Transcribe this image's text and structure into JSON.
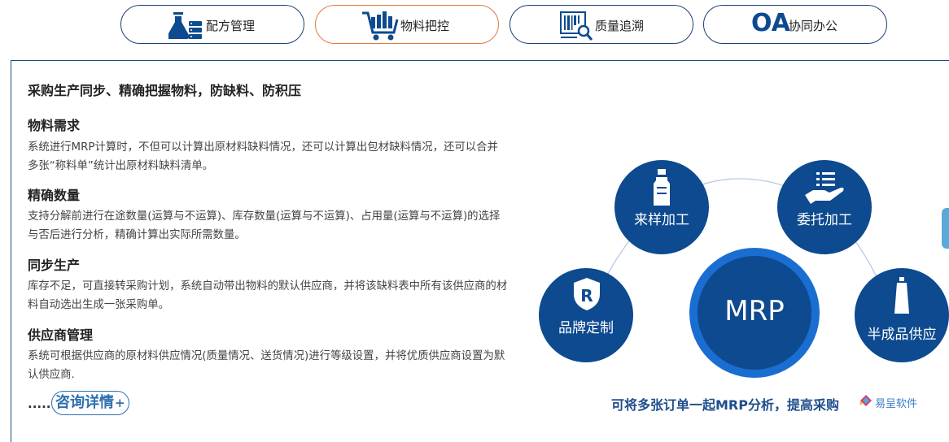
{
  "tabs": [
    {
      "label": "配方管理",
      "icon": "flask-server-icon"
    },
    {
      "label": "物料把控",
      "icon": "shopping-cart-icon",
      "active": true
    },
    {
      "label": "质量追溯",
      "icon": "barcode-search-icon"
    },
    {
      "label": "协同办公",
      "icon": "oa-logo-icon",
      "icon_text": "OA"
    }
  ],
  "headline": "采购生产同步、精确把握物料，防缺料、防积压",
  "sections": [
    {
      "title": "物料需求",
      "body": "系统进行MRP计算时，不但可以计算出原材料缺料情况，还可以计算出包材缺料情况，还可以合并多张“称料单”统计出原材料缺料清单。"
    },
    {
      "title": "精确数量",
      "body": "支持分解前进行在途数量(运算与不运算)、库存数量(运算与不运算)、占用量(运算与不运算)的选择与否后进行分析，精确计算出实际所需数量。"
    },
    {
      "title": "同步生产",
      "body": "库存不足，可直接转采购计划，系统自动带出物料的默认供应商，并将该缺料表中所有该供应商的材料自动选出生成一张采购单。"
    },
    {
      "title": "供应商管理",
      "body": "系统可根据供应商的原材料供应情况(质量情况、送货情况)进行等级设置，并将优质供应商设置为默认供应商."
    }
  ],
  "more": {
    "dots": ".....",
    "consult_label": "咨询详情",
    "consult_plus": "+"
  },
  "diagram": {
    "center": "MRP",
    "nodes": [
      {
        "label": "来样加工",
        "icon": "bottle-icon"
      },
      {
        "label": "委托加工",
        "icon": "hand-list-icon"
      },
      {
        "label": "品牌定制",
        "icon": "r-shield-icon"
      },
      {
        "label": "半成品供应",
        "icon": "tube-icon"
      }
    ],
    "caption": "可将多张订单一起MRP分析，提高采购",
    "brand": "易呈软件"
  },
  "colors": {
    "navy": "#0d4a8f",
    "center_ring": "#1a6ed1",
    "tab_border": "#1d3f73",
    "active_tab_border": "#e07a3a",
    "consult_blue": "#2e6fb0",
    "caption_blue": "#1f4e8c"
  }
}
